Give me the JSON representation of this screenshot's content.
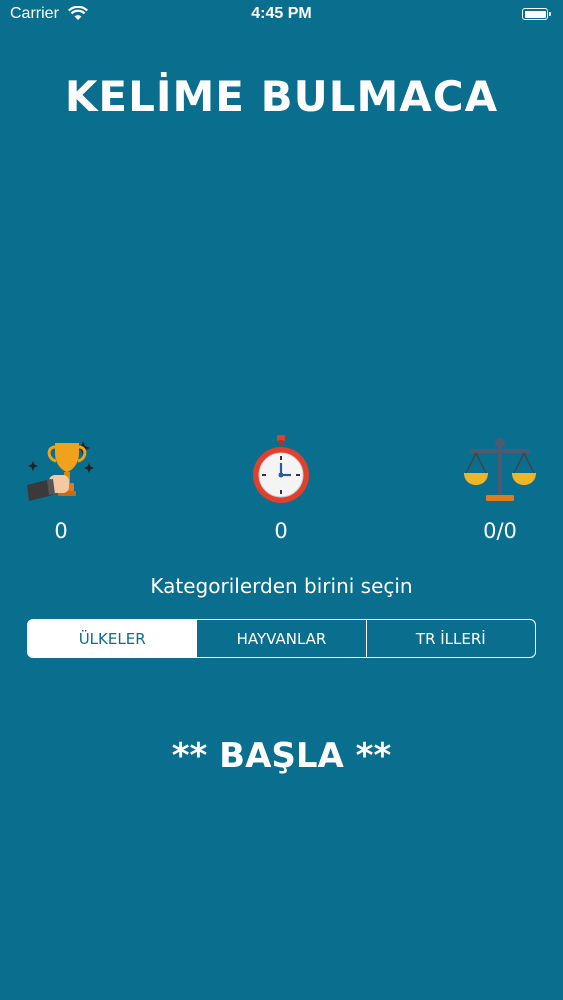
{
  "status_bar": {
    "carrier": "Carrier",
    "time": "4:45 PM"
  },
  "app": {
    "title": "KELİME BULMACA"
  },
  "stats": {
    "trophy": {
      "icon": "trophy-icon",
      "value": "0"
    },
    "timer": {
      "icon": "stopwatch-icon",
      "value": "0"
    },
    "ratio": {
      "icon": "scale-icon",
      "value": "0/0"
    }
  },
  "category": {
    "prompt": "Kategorilerden birini seçin",
    "options": [
      "ÜLKELER",
      "HAYVANLAR",
      "TR İLLERİ"
    ],
    "selected": "ÜLKELER"
  },
  "start_label": "** BAŞLA **",
  "colors": {
    "background": "#0a6e8e",
    "foreground": "#ffffff"
  }
}
